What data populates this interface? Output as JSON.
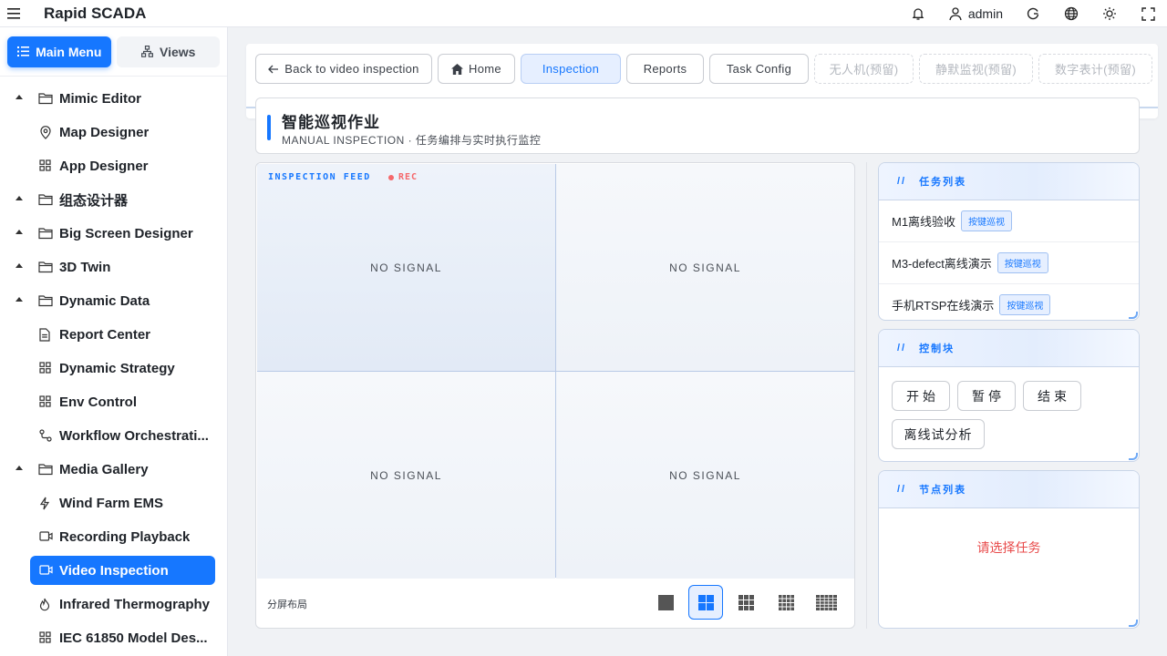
{
  "app": {
    "title": "Rapid SCADA"
  },
  "topbar": {
    "user": "admin",
    "icons": [
      "bell-icon",
      "user-icon",
      "refresh-icon",
      "globe-icon",
      "sun-icon",
      "fullscreen-icon"
    ]
  },
  "sidebar": {
    "tabs": [
      {
        "label": "Main Menu",
        "active": true
      },
      {
        "label": "Views",
        "active": false
      }
    ],
    "items": [
      {
        "label": "Mimic Editor",
        "type": "group",
        "icon": "folder-icon"
      },
      {
        "label": "Map Designer",
        "type": "child",
        "icon": "location-icon"
      },
      {
        "label": "App Designer",
        "type": "child",
        "icon": "grid-icon"
      },
      {
        "label": "组态设计器",
        "type": "group",
        "icon": "folder-icon"
      },
      {
        "label": "Big Screen Designer",
        "type": "group",
        "icon": "folder-icon"
      },
      {
        "label": "3D Twin",
        "type": "group",
        "icon": "folder-icon"
      },
      {
        "label": "Dynamic Data",
        "type": "group",
        "icon": "folder-icon"
      },
      {
        "label": "Report Center",
        "type": "child",
        "icon": "document-icon"
      },
      {
        "label": "Dynamic Strategy",
        "type": "child",
        "icon": "grid-icon"
      },
      {
        "label": "Env Control",
        "type": "child",
        "icon": "grid-icon"
      },
      {
        "label": "Workflow Orchestrati...",
        "type": "child",
        "icon": "workflow-icon"
      },
      {
        "label": "Media Gallery",
        "type": "group",
        "icon": "folder-icon"
      },
      {
        "label": "Wind Farm EMS",
        "type": "child",
        "icon": "lightning-icon"
      },
      {
        "label": "Recording Playback",
        "type": "child",
        "icon": "video-icon"
      },
      {
        "label": "Video Inspection",
        "type": "child",
        "icon": "video-icon",
        "selected": true
      },
      {
        "label": "Infrared Thermography",
        "type": "child",
        "icon": "flame-icon"
      },
      {
        "label": "IEC 61850 Model Des...",
        "type": "child",
        "icon": "grid-icon"
      }
    ]
  },
  "nav": {
    "back": "Back to video inspection",
    "home": "Home",
    "inspection": "Inspection",
    "reports": "Reports",
    "task_config": "Task Config",
    "drone": "无人机(预留)",
    "silent": "静默监视(预留)",
    "meter": "数字表计(预留)"
  },
  "header": {
    "title": "智能巡视作业",
    "subtitle": "MANUAL INSPECTION · 任务编排与实时执行监控"
  },
  "video": {
    "feed_label": "INSPECTION FEED",
    "rec_label": "REC",
    "cells": [
      "NO SIGNAL",
      "NO SIGNAL",
      "NO SIGNAL",
      "NO SIGNAL"
    ],
    "layout_label": "分屏布局",
    "layout_options": [
      "1x1",
      "2x2",
      "3x3",
      "4x4",
      "5x5"
    ],
    "layout_selected": "2x2"
  },
  "tasks": {
    "title": "任务列表",
    "items": [
      {
        "name": "M1离线验收",
        "tag": "按键巡视"
      },
      {
        "name": "M3-defect离线演示",
        "tag": "按键巡视"
      },
      {
        "name": "手机RTSP在线演示",
        "tag": "按键巡视"
      }
    ]
  },
  "control": {
    "title": "控制块",
    "start": "开始",
    "pause": "暂停",
    "end": "结束",
    "offline": "离线试分析"
  },
  "nodes": {
    "title": "节点列表",
    "empty": "请选择任务"
  },
  "colors": {
    "accent": "#1677ff",
    "error": "#e84b4b",
    "rec": "#f5686b"
  }
}
